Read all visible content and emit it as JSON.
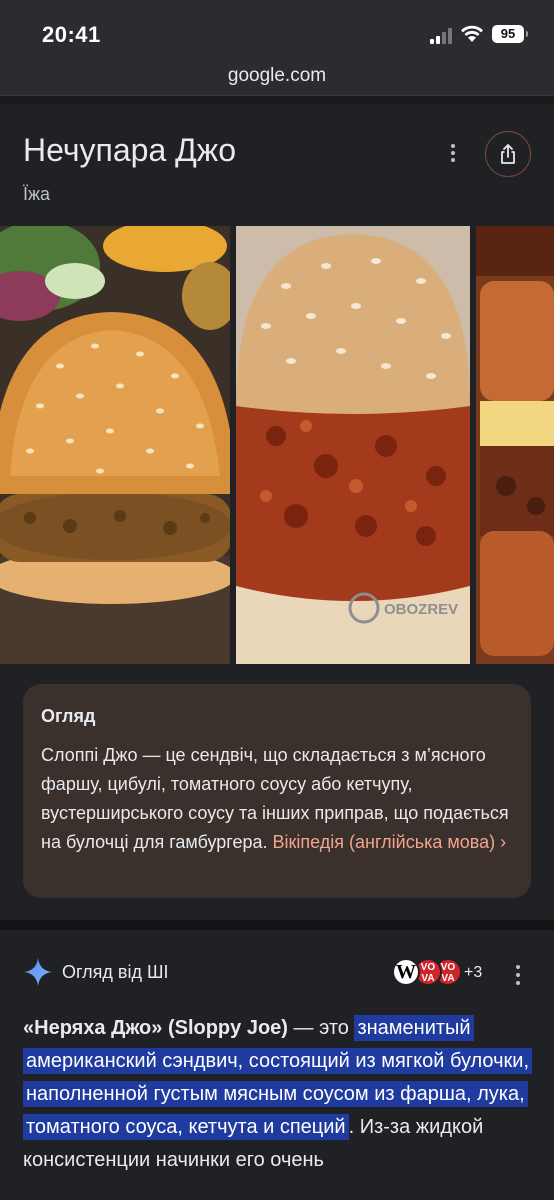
{
  "status_bar": {
    "time": "20:41",
    "battery": "95"
  },
  "browser": {
    "url": "google.com"
  },
  "knowledge_panel": {
    "title": "Нечупара Джо",
    "subtitle": "Їжа",
    "overview": {
      "heading": "Огляд",
      "text": "Слоппі Джо — це сендвіч, що складається з м’ясного фаршу, цибулі, томатного соусу або кетчупу, вустерширського соусу та інших приправ, що подається на булочці для гамбургера.",
      "link_label": "Вікіпедія (англійська мова)",
      "link_chevron": "›"
    },
    "images": [
      "sloppy-joe-burger-photo",
      "sloppy-joe-sandwich-photo",
      "sandwich-photo-partial"
    ],
    "watermark": "OBOZREV"
  },
  "ai_overview": {
    "label": "Огляд від ШІ",
    "sources_more": "+3",
    "source_w": "W",
    "source_vova": "VO VA",
    "lead": "«Неряха Джо» (Sloppy Joe)",
    "dash": " — это ",
    "highlight": "знаменитый американский сэндвич, состоящий из мягкой булочки, наполненной густым мясным соусом из фарша, лука, томатного соуса, кетчута и специй",
    "rest": ". Из-за жидкой консистенции начинки его очень"
  }
}
